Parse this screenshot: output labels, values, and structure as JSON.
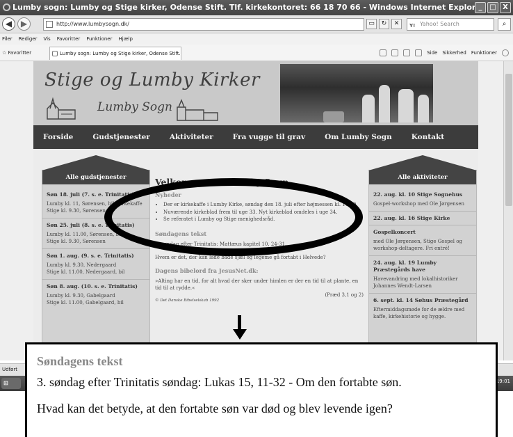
{
  "window": {
    "title": "Lumby sogn: Lumby og Stige kirker, Odense Stift. Tlf. kirkekontoret: 66 18 70 66 - Windows Internet Explorer",
    "controls": [
      "_",
      "□",
      "X"
    ]
  },
  "addressbar": {
    "url": "http://www.lumbysogn.dk/",
    "search_placeholder": "Yahoo! Search"
  },
  "menubar": {
    "items": [
      "Filer",
      "Rediger",
      "Vis",
      "Favoritter",
      "Funktioner",
      "Hjælp"
    ]
  },
  "favbar": {
    "favorites_label": "Favoritter",
    "tab_title": "Lumby sogn: Lumby og Stige kirker, Odense Stift. Tlf. ...",
    "tools": [
      "Side",
      "Sikkerhed",
      "Funktioner"
    ]
  },
  "site": {
    "title": "Stige og Lumby Kirker",
    "subtitle": "Lumby Sogn"
  },
  "nav": {
    "items": [
      "Forside",
      "Gudstjenester",
      "Aktiviteter",
      "Fra vugge til grav",
      "Om Lumby Sogn",
      "Kontakt"
    ]
  },
  "left_sidebar": {
    "heading": "Alle gudstjenester",
    "services": [
      {
        "date": "Søn 18. juli (7. s. e. Trinitatis)",
        "text": "Lumby kl. 11, Sørensen, bil, kirkekaffe\nStige kl. 9.30, Sørensen"
      },
      {
        "date": "Søn 25. juli (8. s. e. Trinitatis)",
        "text": "Lumby kl. 11.00, Sørensen, bil\nStige kl. 9.30, Sørensen"
      },
      {
        "date": "Søn 1. aug. (9. s. e. Trinitatis)",
        "text": "Lumby kl. 9.30, Nedergaard\nStige kl. 11.00, Nedergaard, bil"
      },
      {
        "date": "Søn 8. aug. (10. s. e. Trinitatis)",
        "text": "Lumby kl. 9.30, Gabelgaard\nStige kl. 11.00, Gabelgaard, bil"
      }
    ]
  },
  "main": {
    "heading": "Velkommen til Lumby Sogn",
    "news_heading": "Nyheder",
    "news": [
      "Der er kirkekaffe i Lumby Kirke, søndag den 18. juli efter højmessen kl. 11.00.",
      "Nuværende kirkeblad frem til uge 33. Nyt kirkeblad omdeles i uge 34.",
      "Se referatet i Lumby og Stige menighedsråd."
    ],
    "sunday_heading": "Søndagens tekst",
    "sunday_text": "7. søndag efter Trinitatis: Mattæus kapitel 10, 24-31.",
    "sunday_question": "Hvem er det, der kan lade både sjæl og legeme gå fortabt i Helvede?",
    "bible_heading": "Dagens bibelord fra JesusNet.dk:",
    "bible_text": "»Alting har en tid, for alt hvad der sker under himlen er der en tid til at plante, en tid til at rydde.«",
    "bible_ref": "(Præd 3,1 og 2)",
    "bible_credit": "© Det Danske Bibelselskab 1992"
  },
  "right_sidebar": {
    "heading": "Alle aktiviteter",
    "events": [
      {
        "title": "22. aug. kl. 10 Stige Sognehus",
        "text": "Gospel-workshop med Ole Jørgensen"
      },
      {
        "title": "22. aug. kl. 16 Stige Kirke",
        "text": ""
      },
      {
        "title": "Gospelkoncert",
        "text": "med Ole Jørgensen, Stige Gospel og workshop-deltagere. Fri entré!"
      },
      {
        "title": "24. aug. kl. 19 Lumby Præstegårds have",
        "text": "Havevandring med lokalhistoriker Johannes Wendt-Larsen"
      },
      {
        "title": "6. sept. kl. 14 Søhus Præstegård",
        "text": "Eftermiddagsmøde for de ældre med kaffe, kirkehistorie og hygge."
      }
    ]
  },
  "statusbar": {
    "text": "Udført"
  },
  "taskbar": {
    "clock": "19:01"
  },
  "callout": {
    "heading": "Søndagens tekst",
    "line1": "3. søndag efter Trinitatis søndag: Lukas 15, 11-32 - Om den fortabte søn.",
    "line2": "Hvad kan det betyde, at den fortabte søn var død og blev levende igen?"
  }
}
